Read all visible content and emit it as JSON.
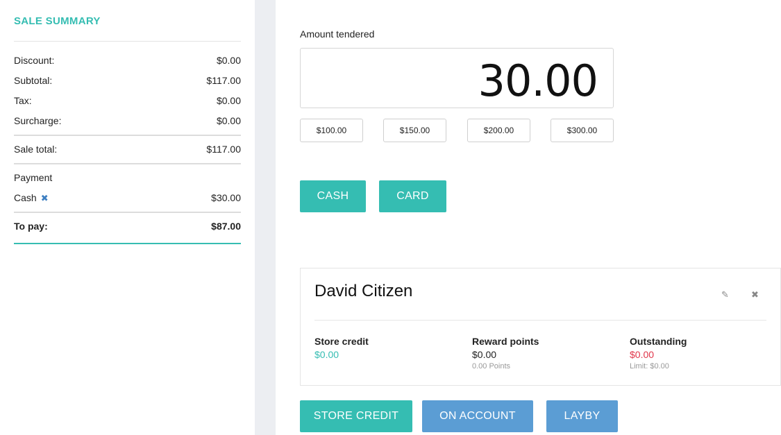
{
  "summary": {
    "title": "SALE SUMMARY",
    "discount": {
      "label": "Discount:",
      "value": "$0.00"
    },
    "subtotal": {
      "label": "Subtotal:",
      "value": "$117.00"
    },
    "tax": {
      "label": "Tax:",
      "value": "$0.00"
    },
    "surcharge": {
      "label": "Surcharge:",
      "value": "$0.00"
    },
    "sale_total": {
      "label": "Sale total:",
      "value": "$117.00"
    },
    "payment_heading": "Payment",
    "payment_line": {
      "label": "Cash",
      "remove_icon": "✖",
      "value": "$30.00"
    },
    "to_pay": {
      "label": "To pay:",
      "value": "$87.00"
    }
  },
  "payment": {
    "amount_label": "Amount tendered",
    "amount_value": "30.00",
    "quick_amounts": [
      "$100.00",
      "$150.00",
      "$200.00",
      "$300.00"
    ],
    "cash_label": "CASH",
    "card_label": "CARD"
  },
  "customer": {
    "name": "David Citizen",
    "edit_icon": "✎",
    "close_icon": "✖",
    "store_credit": {
      "label": "Store credit",
      "value": "$0.00"
    },
    "reward_points": {
      "label": "Reward points",
      "value": "$0.00",
      "sub": "0.00 Points"
    },
    "outstanding": {
      "label": "Outstanding",
      "value": "$0.00",
      "sub": "Limit: $0.00"
    }
  },
  "actions": {
    "store_credit_label": "STORE CREDIT",
    "on_account_label": "ON ACCOUNT",
    "layby_label": "LAYBY"
  },
  "colors": {
    "accent_teal": "#35bdb2",
    "accent_blue": "#5b9dd4",
    "negative_red": "#e0364a"
  }
}
